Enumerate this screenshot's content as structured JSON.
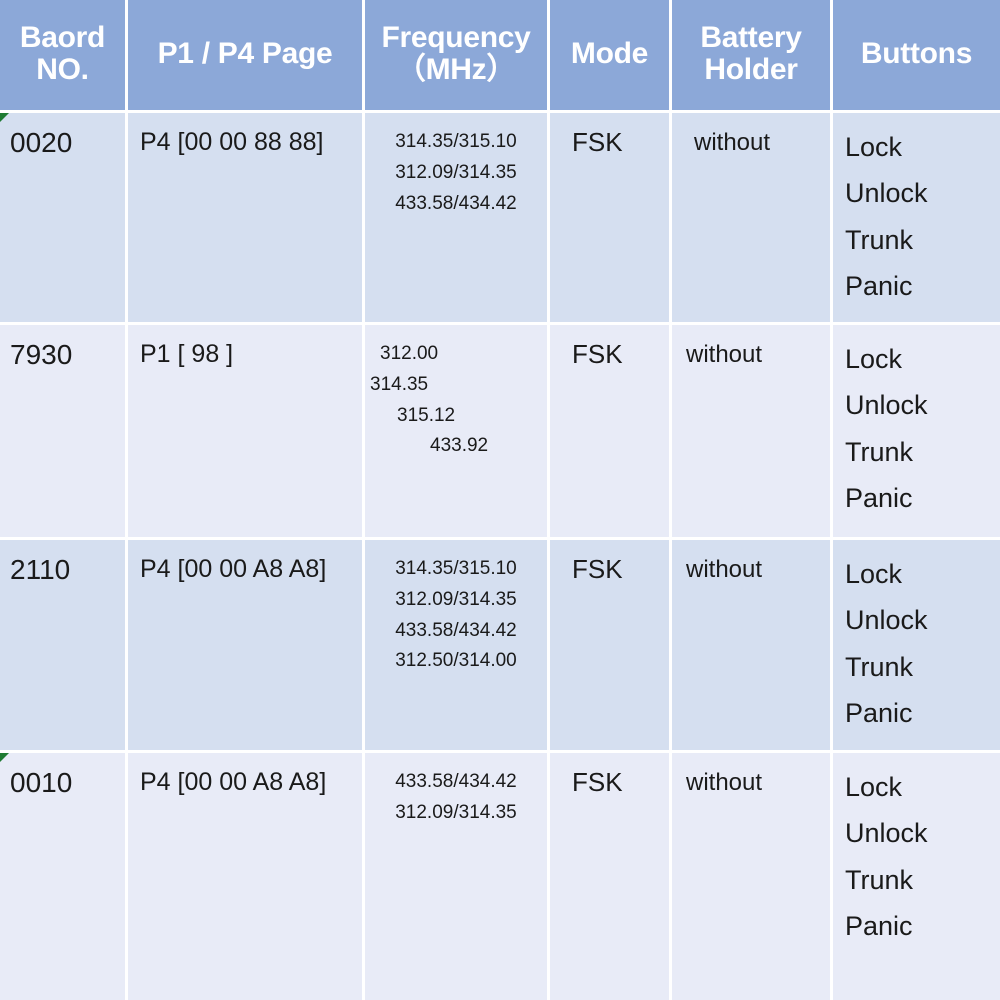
{
  "table": {
    "headers": [
      {
        "label": "Baord NO.",
        "name": "board-no"
      },
      {
        "label": "P1 / P4 Page",
        "name": "page"
      },
      {
        "label": "Frequency（MHz）",
        "name": "frequency"
      },
      {
        "label": "Mode",
        "name": "mode"
      },
      {
        "label": "Battery Holder",
        "name": "battery-holder"
      },
      {
        "label": "Buttons",
        "name": "buttons"
      }
    ],
    "header_lines": {
      "board_no_l1": "Baord",
      "board_no_l2": "NO.",
      "page_l1": "P1 / P4 Page",
      "freq_l1": "Frequency",
      "freq_l2": "（MHz）",
      "mode_l1": "Mode",
      "batt_l1": "Battery",
      "batt_l2": "Holder",
      "buttons_l1": "Buttons"
    },
    "rows": [
      {
        "board_no": "0020",
        "page": "P4 [00 00 88 88]",
        "frequencies": [
          "314.35/315.10",
          "312.09/314.35",
          "433.58/434.42"
        ],
        "mode": "FSK",
        "battery_holder": "without",
        "buttons": [
          "Lock",
          "Unlock",
          "Trunk",
          "Panic"
        ],
        "has_marker": true
      },
      {
        "board_no": "7930",
        "page": "P1 [ 98 ]",
        "frequencies": [
          "312.00",
          "314.35",
          "315.12",
          "433.92"
        ],
        "mode": "FSK",
        "battery_holder": "without",
        "buttons": [
          "Lock",
          "Unlock",
          "Trunk",
          "Panic"
        ],
        "has_marker": false
      },
      {
        "board_no": "2110",
        "page": "P4 [00 00 A8 A8]",
        "frequencies": [
          "314.35/315.10",
          "312.09/314.35",
          "433.58/434.42",
          "312.50/314.00"
        ],
        "mode": "FSK",
        "battery_holder": "without",
        "buttons": [
          "Lock",
          "Unlock",
          "Trunk",
          "Panic"
        ],
        "has_marker": false
      },
      {
        "board_no": "0010",
        "page": "P4 [00 00 A8 A8]",
        "frequencies": [
          "433.58/434.42",
          "312.09/314.35"
        ],
        "mode": "FSK",
        "battery_holder": "without",
        "buttons": [
          "Lock",
          "Unlock",
          "Trunk",
          "Panic"
        ],
        "has_marker": true
      }
    ]
  },
  "colors": {
    "header_bg": "#8ca8d8",
    "header_text": "#ffffff",
    "row_shade_a": "#d5dff0",
    "row_shade_b": "#e8ebf7",
    "gridline": "#ffffff",
    "body_text": "#1a1a1a",
    "marker_green": "#1e7a32"
  }
}
